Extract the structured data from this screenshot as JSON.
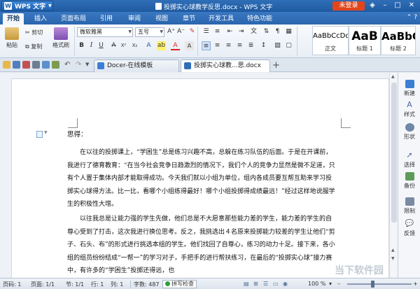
{
  "titlebar": {
    "app_label": "WPS 文字",
    "window_title": "投掷实心球教学反思.docx - WPS 文字",
    "login_label": "未登录"
  },
  "menu": {
    "tabs": [
      "开始",
      "插入",
      "页面布局",
      "引用",
      "审阅",
      "视图",
      "章节",
      "开发工具",
      "特色功能"
    ],
    "active": "开始"
  },
  "ribbon": {
    "paste": "粘贴",
    "cut": "剪切",
    "copy": "复制",
    "format_painter": "格式刷",
    "font_name": "微软雅黑",
    "font_size": "五号",
    "styles": [
      {
        "sample": "AaBbCcDd",
        "label": "正文"
      },
      {
        "sample": "AaB",
        "label": "标题 1"
      },
      {
        "sample": "AaBbC",
        "label": "标题 2"
      }
    ]
  },
  "doc_tabs": [
    {
      "label": "Docer-在线模板",
      "active": false
    },
    {
      "label": "投掷实心球教...思.docx",
      "active": true
    }
  ],
  "document": {
    "heading": "思得：",
    "paragraph1": "在以往的投掷课上，“学困生”总是练习兴趣不高，总躲在练习队伍的后面。于是在开课前，我进行了德育教育：“在当今社会竞争日趋激烈的情况下，我们个人的竞争力显然是微不足道，只有个人置于集体内部才能取得成功。今天我们就以小组为单位，组内各成员要互帮互助来学习投掷实心球得方法。比一比，看哪个小组练得最好！哪个小组投掷得成绩最远！”经过这样地说服学生的积极性大增。",
    "paragraph2": "以往我总是让能力强的学生先做，他们总是不大愿意那些能力差的学生，能力差的学生的自尊心受到了打击，这次我进行换位思考。反之，我挑选出４名原来投掷能力较差的学生让他们“剪子、石头、布”的形式进行挑选本组的学生。他们找回了自尊心，练习的动力十足。接下来，各小组的组员纷纷结成“一帮一”的学习对子，手把手的进行帮扶练习，在最后的“投掷实心球”接力赛中，有许多的“学困生”投掷还得远，也"
  },
  "sidebar": {
    "items": [
      "新建",
      "样式",
      "形状",
      "选择",
      "备份",
      "限制",
      "反馈"
    ]
  },
  "statusbar": {
    "page_num": "页码: 1",
    "pages": "页面: 1/1",
    "section": "节: 1/1",
    "row": "行: 1",
    "col": "列: 1",
    "word_count": "字数: 487",
    "spell_check": "拼写检查",
    "zoom": "100 %"
  },
  "watermark": "当下软件园",
  "colors": {
    "titlebar": "#1f5aa0",
    "login": "#e2451c"
  }
}
